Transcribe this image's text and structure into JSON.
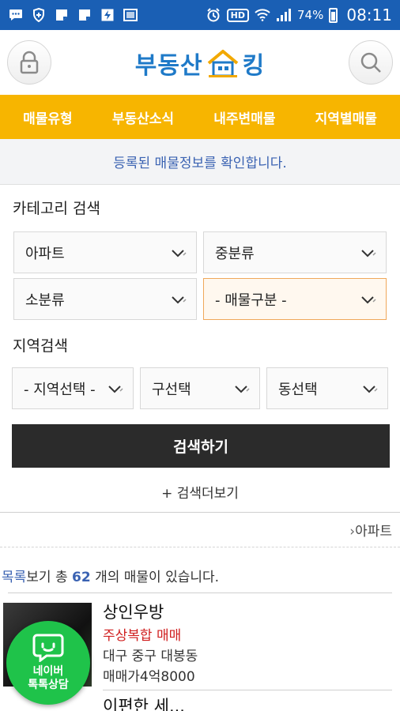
{
  "status_bar": {
    "battery": "74%",
    "time": "08:11",
    "hd_label": "HD",
    "icons": [
      "chat-icon",
      "shield-icon",
      "note-icon",
      "note-icon",
      "flash-icon",
      "image-icon",
      "alarm-icon",
      "hd-icon",
      "wifi-icon",
      "signal-icon",
      "battery-icon"
    ]
  },
  "header": {
    "logo_text_left": "부동산",
    "logo_text_right": "킹",
    "left_icon": "lock-icon",
    "right_icon": "search-icon"
  },
  "nav": {
    "items": [
      "매물유형",
      "부동산소식",
      "내주변매물",
      "지역별매물"
    ]
  },
  "notice": "등록된 매물정보를 확인합니다.",
  "category_search": {
    "title": "카테고리 검색",
    "select1": "아파트",
    "select2": "중분류",
    "select3": "소분류",
    "select4": "- 매물구분 -"
  },
  "region_search": {
    "title": "지역검색",
    "select1": "- 지역선택 -",
    "select2": "구선택",
    "select3": "동선택"
  },
  "search_button": "검색하기",
  "more_search": "+ 검색더보기",
  "breadcrumb": "아파트",
  "result_count": {
    "link": "목록",
    "prefix": "보기 총 ",
    "count": "62",
    "suffix": " 개의 매물이 있습니다."
  },
  "listings": [
    {
      "title": "상인우방",
      "type": "주상복합 매매",
      "address": "대구 중구 대봉동",
      "price": "매매가4억8000"
    },
    {
      "title": "이편한 세..."
    }
  ],
  "talk_button": {
    "line1": "네이버",
    "line2": "톡톡상담"
  },
  "colors": {
    "status_bar": "#1a5fb4",
    "nav_bg": "#f7b500",
    "logo_blue": "#1f7ac8",
    "notice_text": "#3a62b2",
    "listing_type": "#d01f1f",
    "talk_green": "#1fc34a",
    "search_button": "#2b2b2b"
  }
}
